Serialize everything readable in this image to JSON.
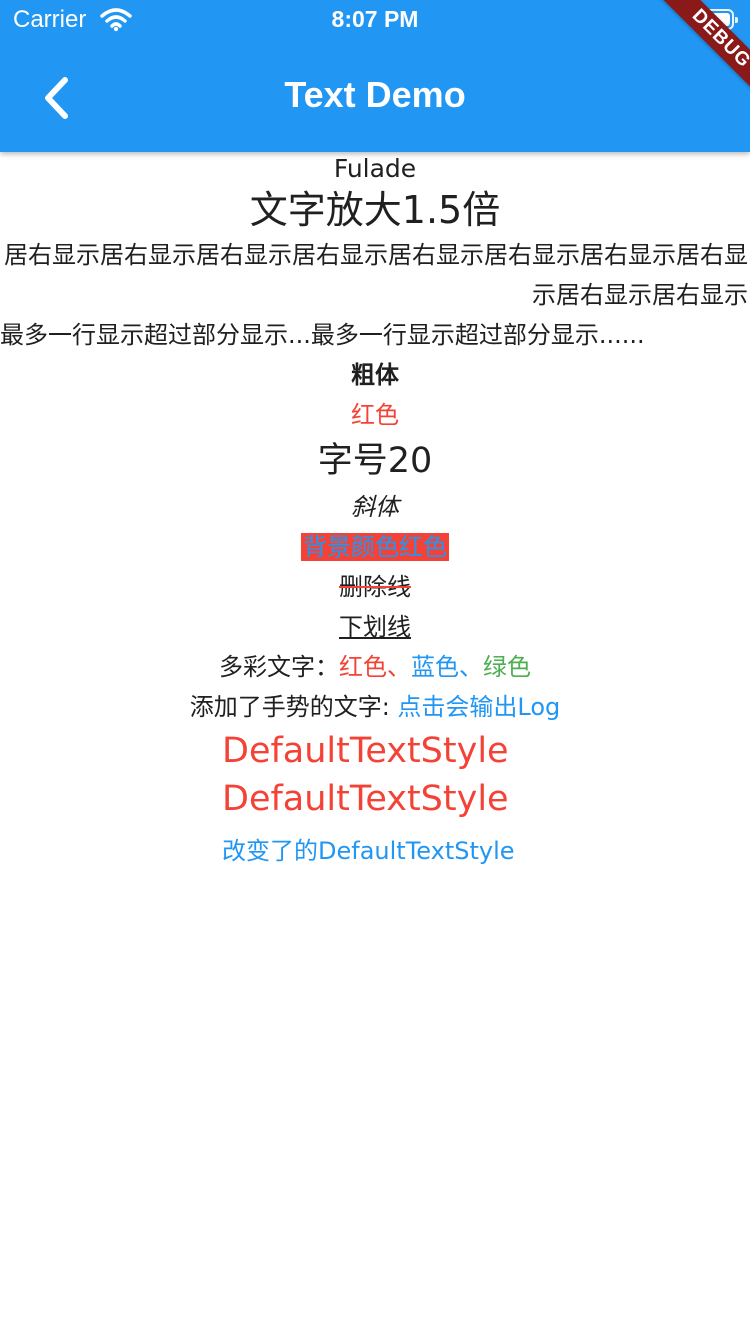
{
  "status_bar": {
    "carrier": "Carrier",
    "time": "8:07 PM",
    "icons": [
      "wifi-icon",
      "battery-icon"
    ]
  },
  "app_bar": {
    "title": "Text Demo",
    "back_icon": "chevron-left-icon",
    "debug_banner": "DEBUG",
    "color": "#2196F3"
  },
  "texts": {
    "fulade": "Fulade",
    "scaled": "文字放大1.5倍",
    "right_aligned": "居右显示居右显示居右显示居右显示居右显示居右显示居右显示居右显示居右显示居右显示",
    "ellipsis": "最多一行显示超过部分显示...最多一行显示超过部分显示......",
    "bold": "粗体",
    "red": "红色",
    "size20": "字号20",
    "italic": "斜体",
    "background_red": "背景颜色红色",
    "strikethrough": "删除线",
    "underline": "下划线",
    "rich_prefix": "多彩文字：",
    "rich_red": "红色、",
    "rich_blue": "蓝色、",
    "rich_green": "绿色",
    "gesture_prefix": "添加了手势的文字: ",
    "gesture_link": "点击会输出Log",
    "default_style_1": "DefaultTextStyle",
    "default_style_2": "DefaultTextStyle",
    "default_style_changed": "改变了的DefaultTextStyle"
  },
  "colors": {
    "red": "#f44336",
    "blue": "#2196F3",
    "green": "#4CAF50",
    "debug": "#8a1a1a"
  }
}
